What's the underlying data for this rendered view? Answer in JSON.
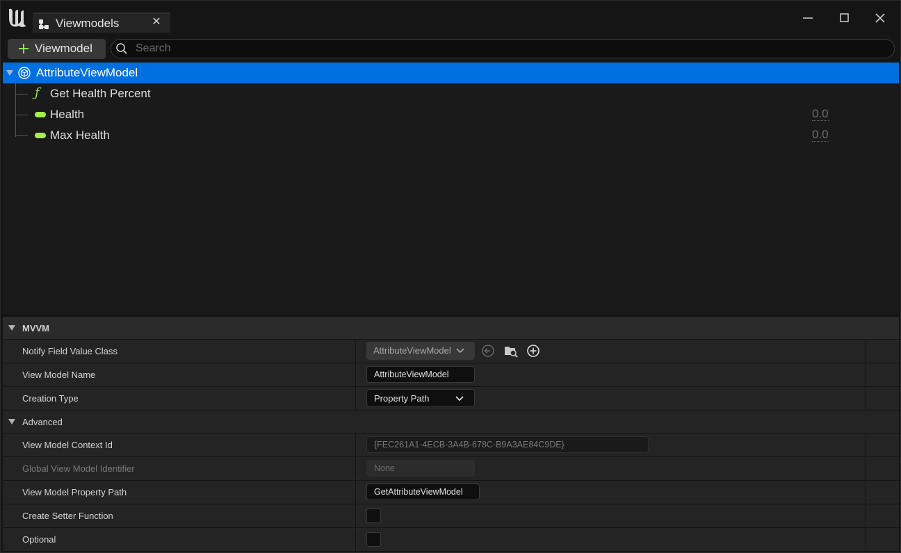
{
  "titlebar": {
    "tab_label": "Viewmodels",
    "logo_icon": "unreal-logo-icon",
    "tab_icon": "viewmodel-hierarchy-icon",
    "close_tab_glyph": "✕"
  },
  "toolbar": {
    "add_label": "Viewmodel",
    "search_placeholder": "Search"
  },
  "tree": {
    "root": {
      "label": "AttributeViewModel",
      "icon": "viewmodel-cube-icon"
    },
    "items": [
      {
        "label": "Get Health Percent",
        "kind": "function",
        "value": ""
      },
      {
        "label": "Health",
        "kind": "float",
        "value": "0.0"
      },
      {
        "label": "Max Health",
        "kind": "float",
        "value": "0.0"
      }
    ]
  },
  "details": {
    "category": "MVVM",
    "props": {
      "notify_class": {
        "name": "Notify Field Value Class",
        "value": "AttributeViewModel"
      },
      "vm_name": {
        "name": "View Model Name",
        "value": "AttributeViewModel"
      },
      "creation_type": {
        "name": "Creation Type",
        "value": "Property Path"
      }
    },
    "advanced": {
      "label": "Advanced",
      "context_id": {
        "name": "View Model Context Id",
        "value": "{FEC261A1-4ECB-3A4B-678C-B9A3AE84C9DE}"
      },
      "global_id": {
        "name": "Global View Model Identifier",
        "value": "None"
      },
      "property_path": {
        "name": "View Model Property Path",
        "value": "GetAttributeViewModel"
      },
      "create_setter": {
        "name": "Create Setter Function",
        "checked": false
      },
      "optional": {
        "name": "Optional",
        "checked": false
      }
    }
  },
  "colors": {
    "selection": "#0070e0",
    "accent_green": "#8ee05a",
    "float_pin": "#a6f04a"
  }
}
